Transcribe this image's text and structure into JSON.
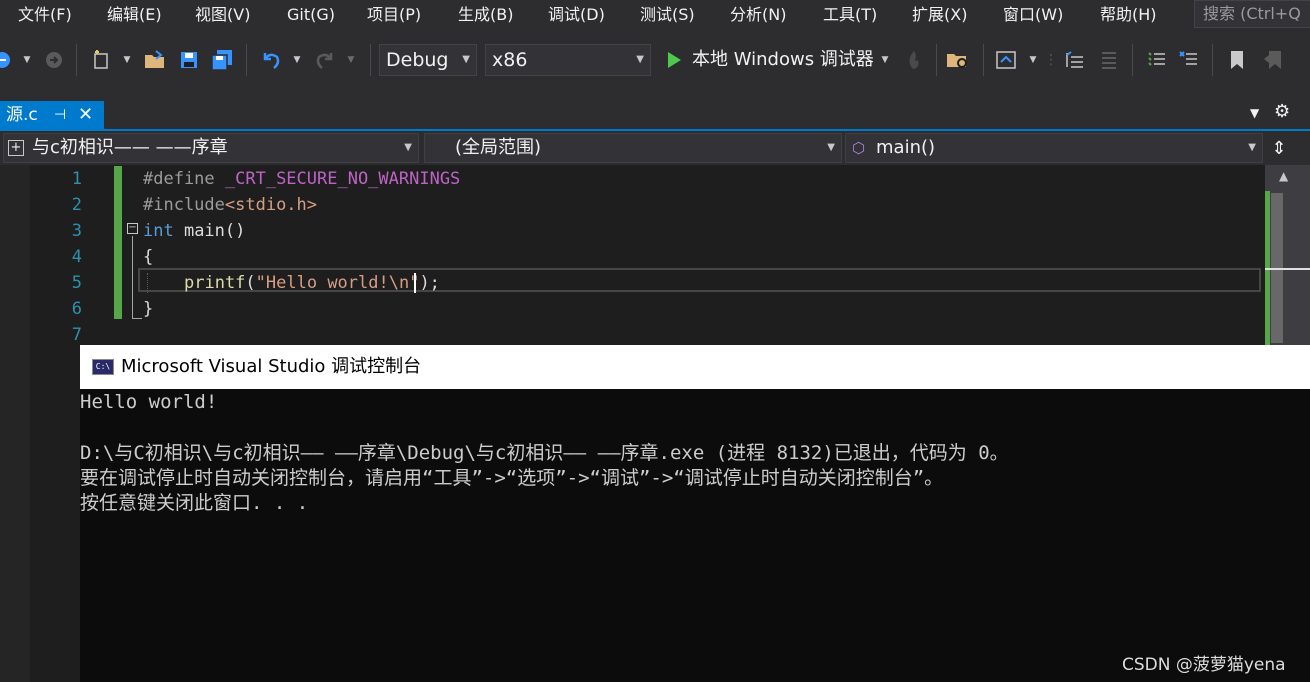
{
  "menu": {
    "items": [
      "文件(F)",
      "编辑(E)",
      "视图(V)",
      "Git(G)",
      "项目(P)",
      "生成(B)",
      "调试(D)",
      "测试(S)",
      "分析(N)",
      "工具(T)",
      "扩展(X)",
      "窗口(W)",
      "帮助(H)"
    ],
    "search_placeholder": "搜索 (Ctrl+Q"
  },
  "toolbar": {
    "config": "Debug",
    "platform": "x86",
    "run_label": "本地 Windows 调试器",
    "icons": [
      "back-icon",
      "forward-icon",
      "new-item-icon",
      "open-folder-icon",
      "save-icon",
      "save-all-icon",
      "undo-icon",
      "redo-icon",
      "start-debug-icon",
      "hot-reload-icon",
      "find-folder-icon",
      "solution-explorer-icon",
      "step-icon",
      "comment-icon",
      "uncomment-icon",
      "bookmark-icon",
      "prev-bookmark-icon"
    ]
  },
  "tabs": {
    "active": "源.c"
  },
  "navbar": {
    "project": "与c初相识—— ——序章",
    "scope": "(全局范围)",
    "member": "main()"
  },
  "editor": {
    "line_numbers": [
      "1",
      "2",
      "3",
      "4",
      "5",
      "6",
      "7"
    ],
    "line1": {
      "pre": "#define",
      "macro": " _CRT_SECURE_NO_WARNINGS"
    },
    "line2": {
      "pre": "#include",
      "str": "<stdio.h>"
    },
    "line3": {
      "kw": "int",
      "rest": " main()"
    },
    "line4": "{",
    "line5": {
      "fn": "printf",
      "open": "(",
      "str": "\"Hello world!\\n\"",
      "close": ");"
    },
    "line6": "}"
  },
  "console": {
    "title": "Microsoft Visual Studio 调试控制台",
    "lines": [
      "Hello world!",
      "",
      "D:\\与C初相识\\与c初相识—— ——序章\\Debug\\与c初相识—— ——序章.exe (进程 8132)已退出，代码为 0。",
      "要在调试停止时自动关闭控制台，请启用“工具”->“选项”->“调试”->“调试停止时自动关闭控制台”。",
      "按任意键关闭此窗口. . ."
    ]
  },
  "watermark": "CSDN @菠萝猫yena",
  "colors": {
    "accent": "#007acc",
    "keyword": "#569cd6",
    "string": "#d69d85",
    "macro": "#bd63c5",
    "preprocessor": "#9b9b9b",
    "function": "#dcdcaa",
    "line_number": "#2b91af",
    "change_bar": "#57a64a"
  }
}
